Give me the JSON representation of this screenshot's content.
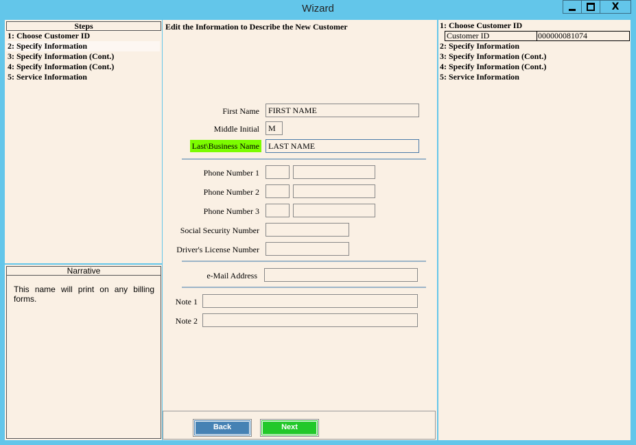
{
  "window": {
    "title": "Wizard",
    "minimize": "minimize",
    "maximize": "maximize",
    "close": "X"
  },
  "steps": {
    "header": "Steps",
    "items": [
      {
        "label": "1: Choose Customer ID"
      },
      {
        "label": "2: Specify Information"
      },
      {
        "label": "3: Specify Information (Cont.)"
      },
      {
        "label": "4: Specify Information (Cont.)"
      },
      {
        "label": "5: Service Information"
      }
    ]
  },
  "narrative": {
    "header": "Narrative",
    "text": "This name will print on any billing forms."
  },
  "form": {
    "title": "Edit the Information to Describe the New Customer",
    "first_name": {
      "label": "First Name",
      "value": "FIRST NAME"
    },
    "middle_initial": {
      "label": "Middle Initial",
      "value": "M"
    },
    "last_name": {
      "label": "Last\\Business Name",
      "value": "LAST NAME"
    },
    "phone1": {
      "label": "Phone Number 1",
      "area": "",
      "number": ""
    },
    "phone2": {
      "label": "Phone Number 2",
      "area": "",
      "number": ""
    },
    "phone3": {
      "label": "Phone Number 3",
      "area": "",
      "number": ""
    },
    "ssn": {
      "label": "Social Security Number",
      "value": ""
    },
    "license": {
      "label": "Driver's License Number",
      "value": ""
    },
    "email": {
      "label": "e-Mail Address",
      "value": ""
    },
    "note1": {
      "label": "Note 1",
      "value": ""
    },
    "note2": {
      "label": "Note 2",
      "value": ""
    },
    "back_label": "Back",
    "next_label": "Next"
  },
  "summary": {
    "step1": "1: Choose Customer ID",
    "customer_id_label": "Customer ID",
    "customer_id_value": "000000081074",
    "step2": "2: Specify Information",
    "step3": "3: Specify Information (Cont.)",
    "step4": "4: Specify Information (Cont.)",
    "step5": "5: Service Information"
  },
  "colors": {
    "frame": "#63c6ea",
    "panel": "#faf0e4",
    "highlight": "#7cfc00",
    "back_button": "#4682b4",
    "next_button": "#22c82a"
  }
}
